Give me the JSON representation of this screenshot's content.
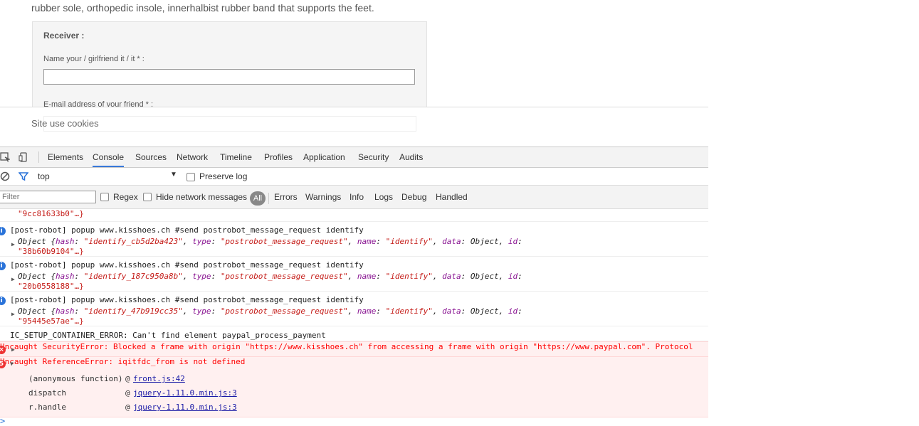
{
  "page": {
    "description": "rubber sole, orthopedic insole, innerhalbist rubber band that supports the feet.",
    "receiver_title": "Receiver :",
    "name_label": "Name your / girlfriend it / it * :",
    "email_label": "E-mail address of your friend * :",
    "cookie_text": "Site use cookies"
  },
  "devtools": {
    "tabs": [
      "Elements",
      "Console",
      "Sources",
      "Network",
      "Timeline",
      "Profiles",
      "Application",
      "Security",
      "Audits"
    ],
    "active_tab": "Console",
    "context": "top",
    "preserve_log": "Preserve log",
    "filter_placeholder": "Filter",
    "regex": "Regex",
    "hide_network": "Hide network messages",
    "levels": [
      "All",
      "Errors",
      "Warnings",
      "Info",
      "Logs",
      "Debug",
      "Handled"
    ]
  },
  "console": {
    "top_fragment": "\"9cc81633b0\"…}",
    "messages": [
      {
        "text": "[post-robot] popup www.kisshoes.ch #send postrobot_message_request identify",
        "hash": "\"identify_cb5d2ba423\"",
        "id": "\"38b60b9104\"…}"
      },
      {
        "text": "[post-robot] popup www.kisshoes.ch #send postrobot_message_request identify",
        "hash": "\"identify_187c950a8b\"",
        "id": "\"20b0558188\"…}"
      },
      {
        "text": "[post-robot] popup www.kisshoes.ch #send postrobot_message_request identify",
        "hash": "\"identify_47b919cc35\"",
        "id": "\"95445e57ae\"…}"
      }
    ],
    "obj_prefix": "Object {",
    "key_hash": "hash",
    "key_type": "type",
    "val_type": "\"postrobot_message_request\"",
    "key_name": "name",
    "val_name": "\"identify\"",
    "key_data": "data",
    "val_data": "Object",
    "key_id": "id",
    "setup_error": "IC_SETUP_CONTAINER_ERROR: Can't find element paypal_process_payment",
    "security_error": "Uncaught SecurityError: Blocked a frame with origin \"https://www.kisshoes.ch\" from accessing a frame with origin \"https://www.paypal.com\". Protocol",
    "reference_error": "Uncaught ReferenceError: iqitfdc_from is not defined",
    "error_count": "5",
    "stack": [
      {
        "fn": "(anonymous function)",
        "file": "front.js:42"
      },
      {
        "fn": "dispatch",
        "file": "jquery-1.11.0.min.js:3"
      },
      {
        "fn": "r.handle",
        "file": "jquery-1.11.0.min.js:3"
      }
    ],
    "prompt": ">"
  }
}
